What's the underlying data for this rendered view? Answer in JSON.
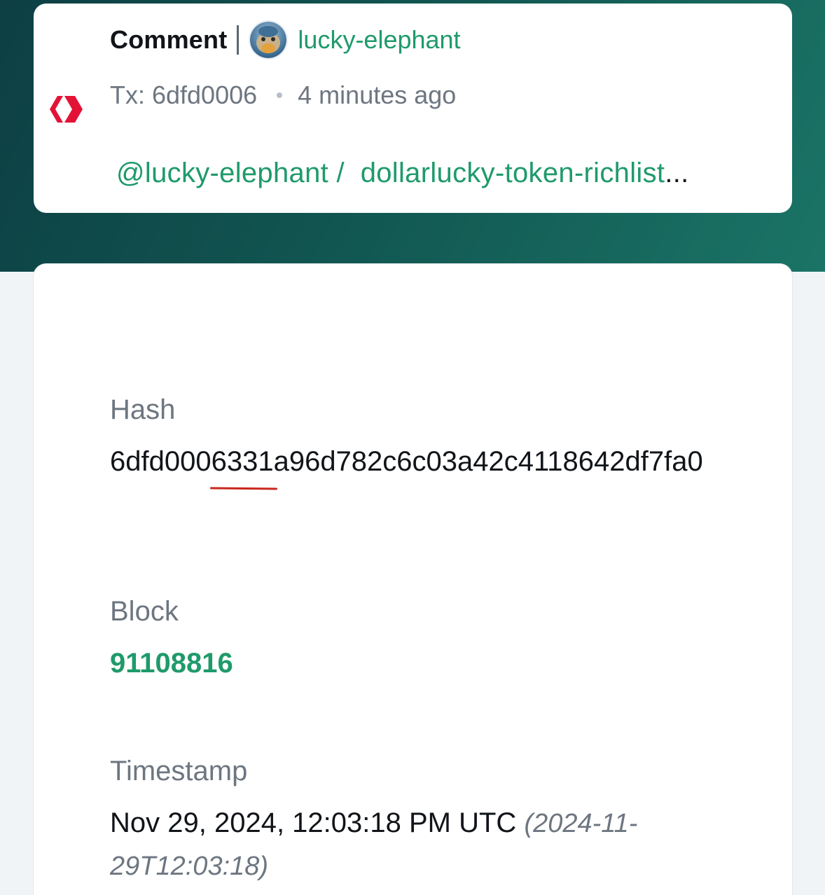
{
  "transaction": {
    "operation_type": "Comment",
    "author": "lucky-elephant",
    "tx_label": "Tx: 6dfd0006",
    "time_ago": "4 minutes ago",
    "permlink_author": "@lucky-elephant /",
    "permlink": "dollarlucky-token-richlist",
    "permlink_ellipsis": "..."
  },
  "details": {
    "hash_label": "Hash",
    "hash_value": "6dfd0006331a96d782c6c03a42c4118642df7fa0",
    "block_label": "Block",
    "block_value": "91108816",
    "timestamp_label": "Timestamp",
    "timestamp_value": "Nov 29, 2024, 12:03:18 PM UTC",
    "timestamp_iso": "(2024-11-29T12:03:18)"
  },
  "colors": {
    "accent_green": "#1f9a6b",
    "hive_red": "#e31337",
    "hero_dark": "#0d3f44",
    "annotation_red": "#c8281e"
  },
  "icons": {
    "hive_logo": "hive-logo-icon",
    "avatar": "user-avatar"
  }
}
